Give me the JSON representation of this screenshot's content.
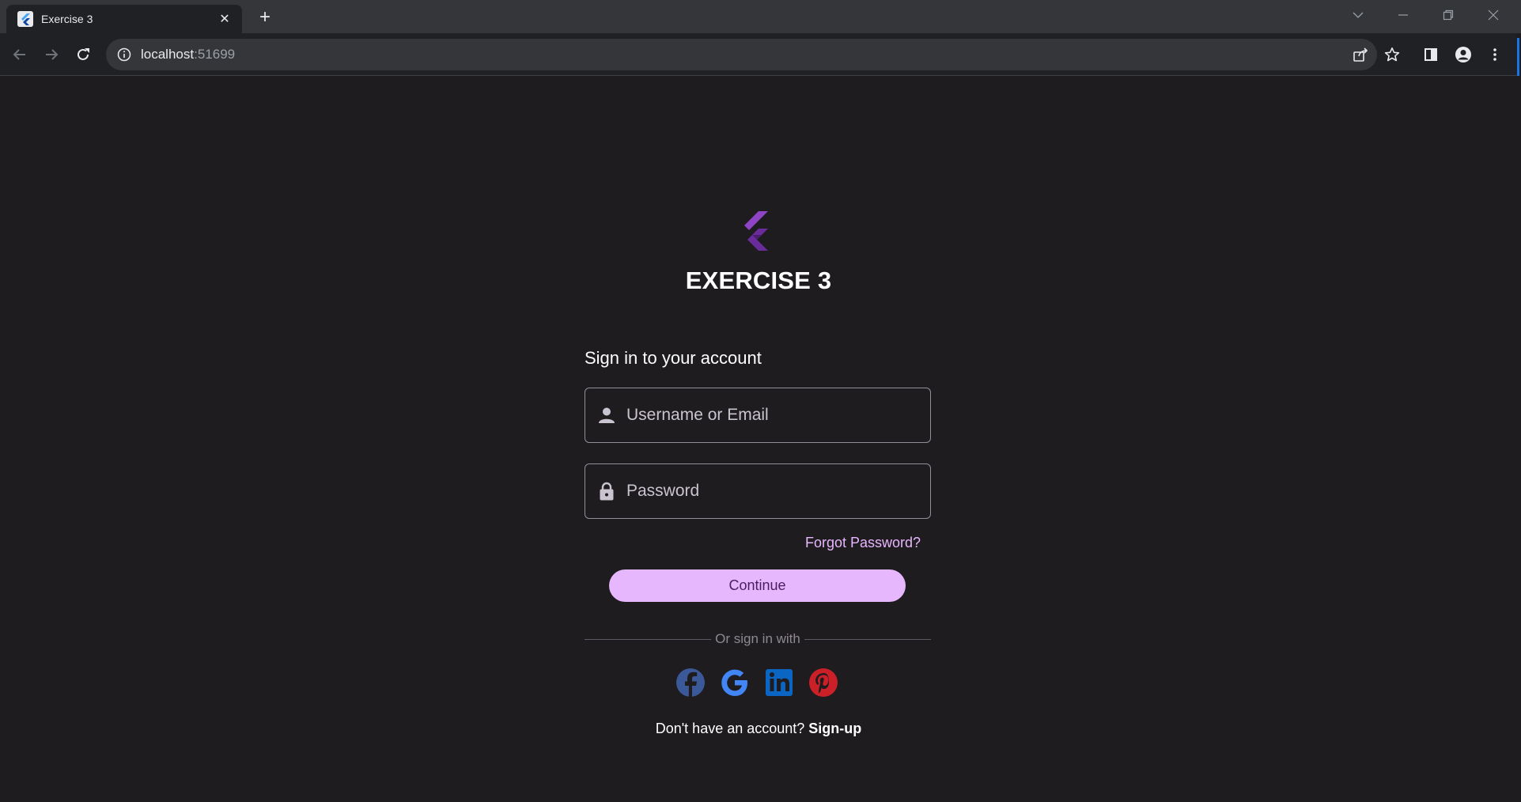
{
  "browser": {
    "tab_title": "Exercise 3",
    "tab_close_icon": "close-icon",
    "new_tab_icon": "plus-icon",
    "url_host": "localhost",
    "url_port": ":51699"
  },
  "app": {
    "title": "EXERCISE 3",
    "logo_icon": "flutter-logo",
    "signin_heading": "Sign in to your account",
    "username_placeholder": "Username or Email",
    "password_placeholder": "Password",
    "forgot_password": "Forgot Password?",
    "continue_label": "Continue",
    "divider_text": "Or sign in with",
    "social_icons": [
      "facebook-icon",
      "google-icon",
      "linkedin-icon",
      "pinterest-icon"
    ],
    "no_account_text": "Don't have an account? ",
    "signup_link": "Sign-up"
  },
  "colors": {
    "background": "#1e1c1f",
    "accent": "#e7b7fd",
    "accent_text": "#4a1e61",
    "link": "#e8b6ff",
    "facebook": "#3b5998",
    "google": "#4285f4",
    "linkedin": "#0a66c2",
    "pinterest": "#cb2027"
  }
}
